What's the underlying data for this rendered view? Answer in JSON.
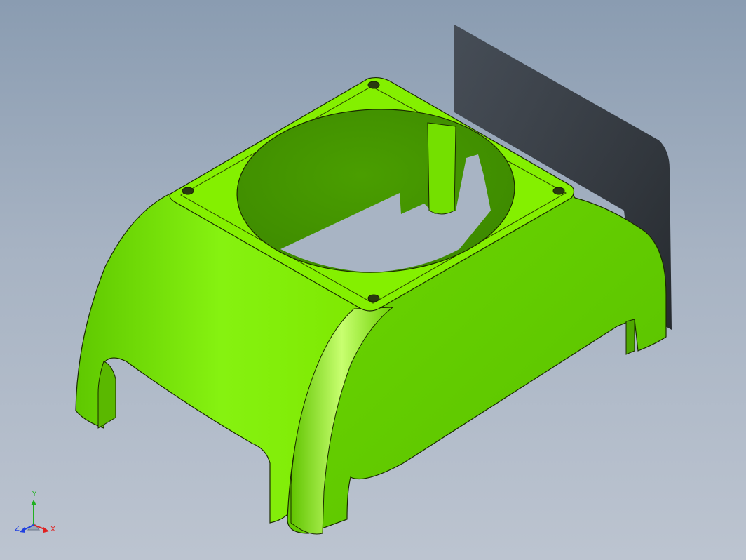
{
  "viewport": {
    "background_top": "#8a9cb1",
    "background_bottom": "#bcc4d0"
  },
  "model": {
    "part_color": "#7ff000",
    "part_shade": "#52b800",
    "part_highlight": "#b6ff5a",
    "edge_color": "#1a2a00",
    "shadow_color": "#2a2e34"
  },
  "triad": {
    "x_label": "X",
    "y_label": "Y",
    "z_label": "Z",
    "x_color": "#e02020",
    "y_color": "#20b020",
    "z_color": "#2040e0"
  }
}
